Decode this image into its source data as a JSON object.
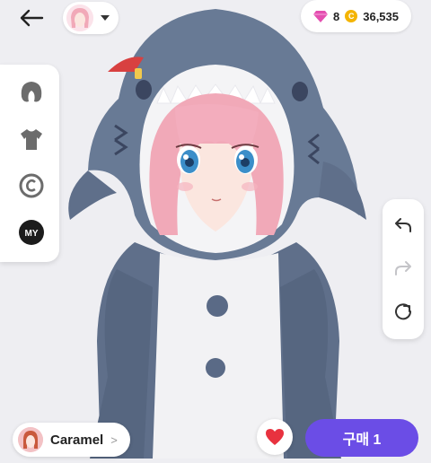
{
  "topbar": {
    "back_icon": "arrow-left-icon",
    "gems": "8",
    "coins": "36,535",
    "gem_color": "#e44fb0",
    "coin_color": "#f4b400"
  },
  "left_tools": [
    {
      "icon": "hair-icon"
    },
    {
      "icon": "clothing-icon"
    },
    {
      "icon": "copyright-icon"
    },
    {
      "icon": "my-icon",
      "label": "MY"
    }
  ],
  "right_tools": [
    {
      "icon": "undo-icon"
    },
    {
      "icon": "redo-icon"
    },
    {
      "icon": "reset-icon"
    }
  ],
  "bottom": {
    "character_name": "Caramel",
    "buy_label": "구매 1",
    "buy_color": "#6b4de6",
    "heart_color": "#e8323f"
  }
}
